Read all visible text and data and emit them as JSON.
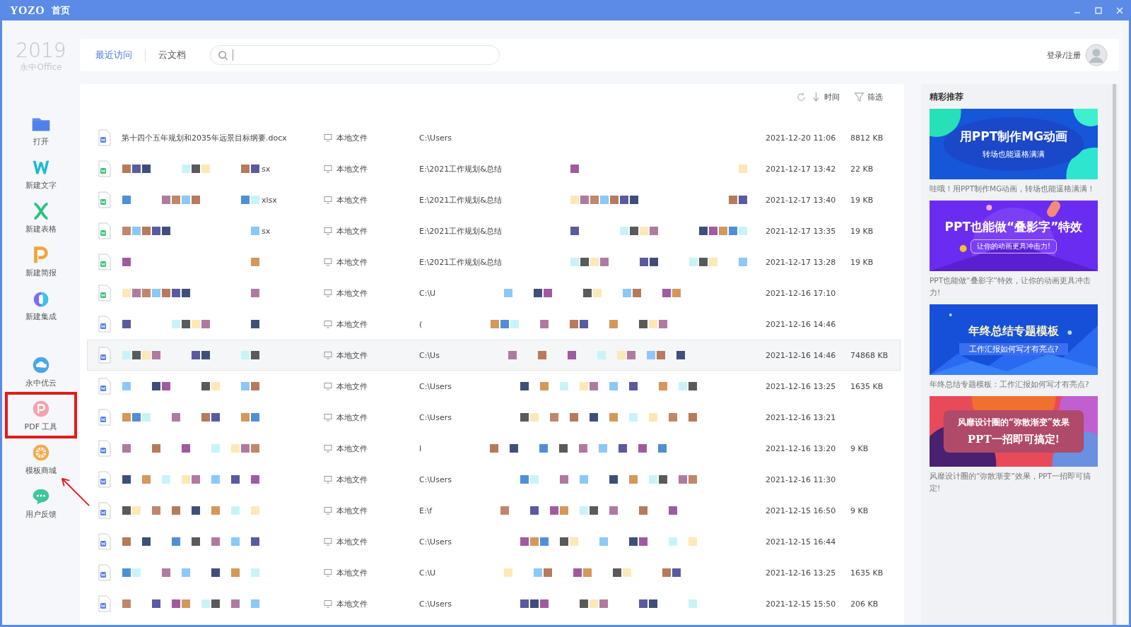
{
  "window": {
    "logo": "YOZO",
    "title": "首页"
  },
  "brand": {
    "year": "2019",
    "product": "永中Office"
  },
  "sidebar": {
    "top_items": [
      {
        "kind": "folder",
        "label": "打开"
      },
      {
        "kind": "writer",
        "label": "新建文字"
      },
      {
        "kind": "sheet",
        "label": "新建表格"
      },
      {
        "kind": "slides",
        "label": "新建简报"
      },
      {
        "kind": "suite",
        "label": "新建集成"
      }
    ],
    "bottom_items": [
      {
        "kind": "cloud",
        "label": "永中优云",
        "annotated": false
      },
      {
        "kind": "pdf",
        "label": "PDF 工具",
        "annotated": true
      },
      {
        "kind": "store",
        "label": "模板商城",
        "annotated": false
      },
      {
        "kind": "feedback",
        "label": "用户反馈",
        "annotated": false
      }
    ]
  },
  "tabs": [
    {
      "label": "最近访问",
      "selected": true
    },
    {
      "label": "云文档",
      "selected": false
    }
  ],
  "login": {
    "label": "登录/注册"
  },
  "toolbar": {
    "sort": "时间",
    "filter": "筛选"
  },
  "files": [
    {
      "kind": "writer",
      "name": "第十四个五年规划和2035年远景目标纲要.docx",
      "type": "本地文件",
      "path": "C:\\Users",
      "date": "2021-12-20 11:06",
      "size": "8812 KB",
      "redacted": false,
      "selected": false
    },
    {
      "kind": "sheet",
      "name": "sx",
      "type": "本地文件",
      "path": "E:\\2021工作规划&总结",
      "date": "2021-12-17 13:42",
      "size": "22 KB",
      "redacted": true,
      "selected": false
    },
    {
      "kind": "sheet",
      "name": "xlsx",
      "type": "本地文件",
      "path": "E:\\2021工作规划&总结",
      "date": "2021-12-17 13:40",
      "size": "19 KB",
      "redacted": true,
      "selected": false
    },
    {
      "kind": "sheet",
      "name": "sx",
      "type": "本地文件",
      "path": "E:\\2021工作规划&总结",
      "date": "2021-12-17 13:35",
      "size": "19 KB",
      "redacted": true,
      "selected": false
    },
    {
      "kind": "sheet",
      "type": "本地文件",
      "path": "E:\\2021工作规划&总结",
      "date": "2021-12-17 13:28",
      "size": "19 KB",
      "redacted": true,
      "selected": false
    },
    {
      "kind": "sheet",
      "type": "本地文件",
      "path": "C:\\U",
      "date": "2021-12-16 17:10",
      "redacted": true,
      "selected": false
    },
    {
      "kind": "writer",
      "type": "本地文件",
      "path": "(",
      "date": "2021-12-16 14:46",
      "redacted": true,
      "selected": false
    },
    {
      "kind": "writer",
      "type": "本地文件",
      "path": "C:\\Us",
      "date": "2021-12-16 14:46",
      "size": "74868 KB",
      "redacted": true,
      "selected": true
    },
    {
      "kind": "writer",
      "type": "本地文件",
      "path": "C:\\Users",
      "date": "2021-12-16 13:25",
      "size": "1635 KB",
      "redacted": true,
      "selected": false
    },
    {
      "kind": "writer",
      "type": "本地文件",
      "path": "C:\\Users",
      "date": "2021-12-16 13:21",
      "redacted": true,
      "selected": false
    },
    {
      "kind": "writer",
      "type": "本地文件",
      "path": "I",
      "date": "2021-12-16 13:20",
      "size": "9 KB",
      "redacted": true,
      "selected": false
    },
    {
      "kind": "writer",
      "type": "本地文件",
      "path": "C:\\Users",
      "date": "2021-12-16 11:30",
      "redacted": true,
      "selected": false
    },
    {
      "kind": "writer",
      "type": "本地文件",
      "path": "E:\\f",
      "date": "2021-12-15 16:50",
      "size": "9 KB",
      "redacted": true,
      "selected": false
    },
    {
      "kind": "writer",
      "type": "本地文件",
      "path": "C:\\Users",
      "date": "2021-12-15 16:44",
      "redacted": true,
      "selected": false
    },
    {
      "kind": "writer",
      "type": "本地文件",
      "path": "C:\\U",
      "date": "2021-12-16 13:25",
      "size": "1635 KB",
      "redacted": true,
      "selected": false
    },
    {
      "kind": "writer",
      "type": "本地文件",
      "path": "C:\\Users",
      "date": "2021-12-15 15:50",
      "size": "206 KB",
      "redacted": true,
      "selected": false
    }
  ],
  "recommend": {
    "title": "精彩推荐",
    "items": [
      {
        "kind": "wave",
        "headline": "用PPT制作MG动画",
        "subline": "转场也能逼格满满",
        "caption": "哇哦！用PPT制作MG动画，转场也能逼格满满！"
      },
      {
        "kind": "violet",
        "headline": "PPT也能做“叠影字”特效",
        "subline": "让你的动画更具冲击力!",
        "caption": "PPT也能做“叠影字”特效，让你的动画更具冲击力!"
      },
      {
        "kind": "mountain",
        "headline": "年终总结专题模板",
        "subline": "工作汇报如何写才有亮点?",
        "caption": "年终总结专题模板：工作汇报如何写才有亮点?"
      },
      {
        "kind": "sunset",
        "headline": "风靡设计圈的“弥散渐变”效果",
        "subline": "PPT一招即可搞定!",
        "caption": "风靡设计圈的“弥散渐变”效果，PPT一招即可搞定!"
      }
    ]
  }
}
